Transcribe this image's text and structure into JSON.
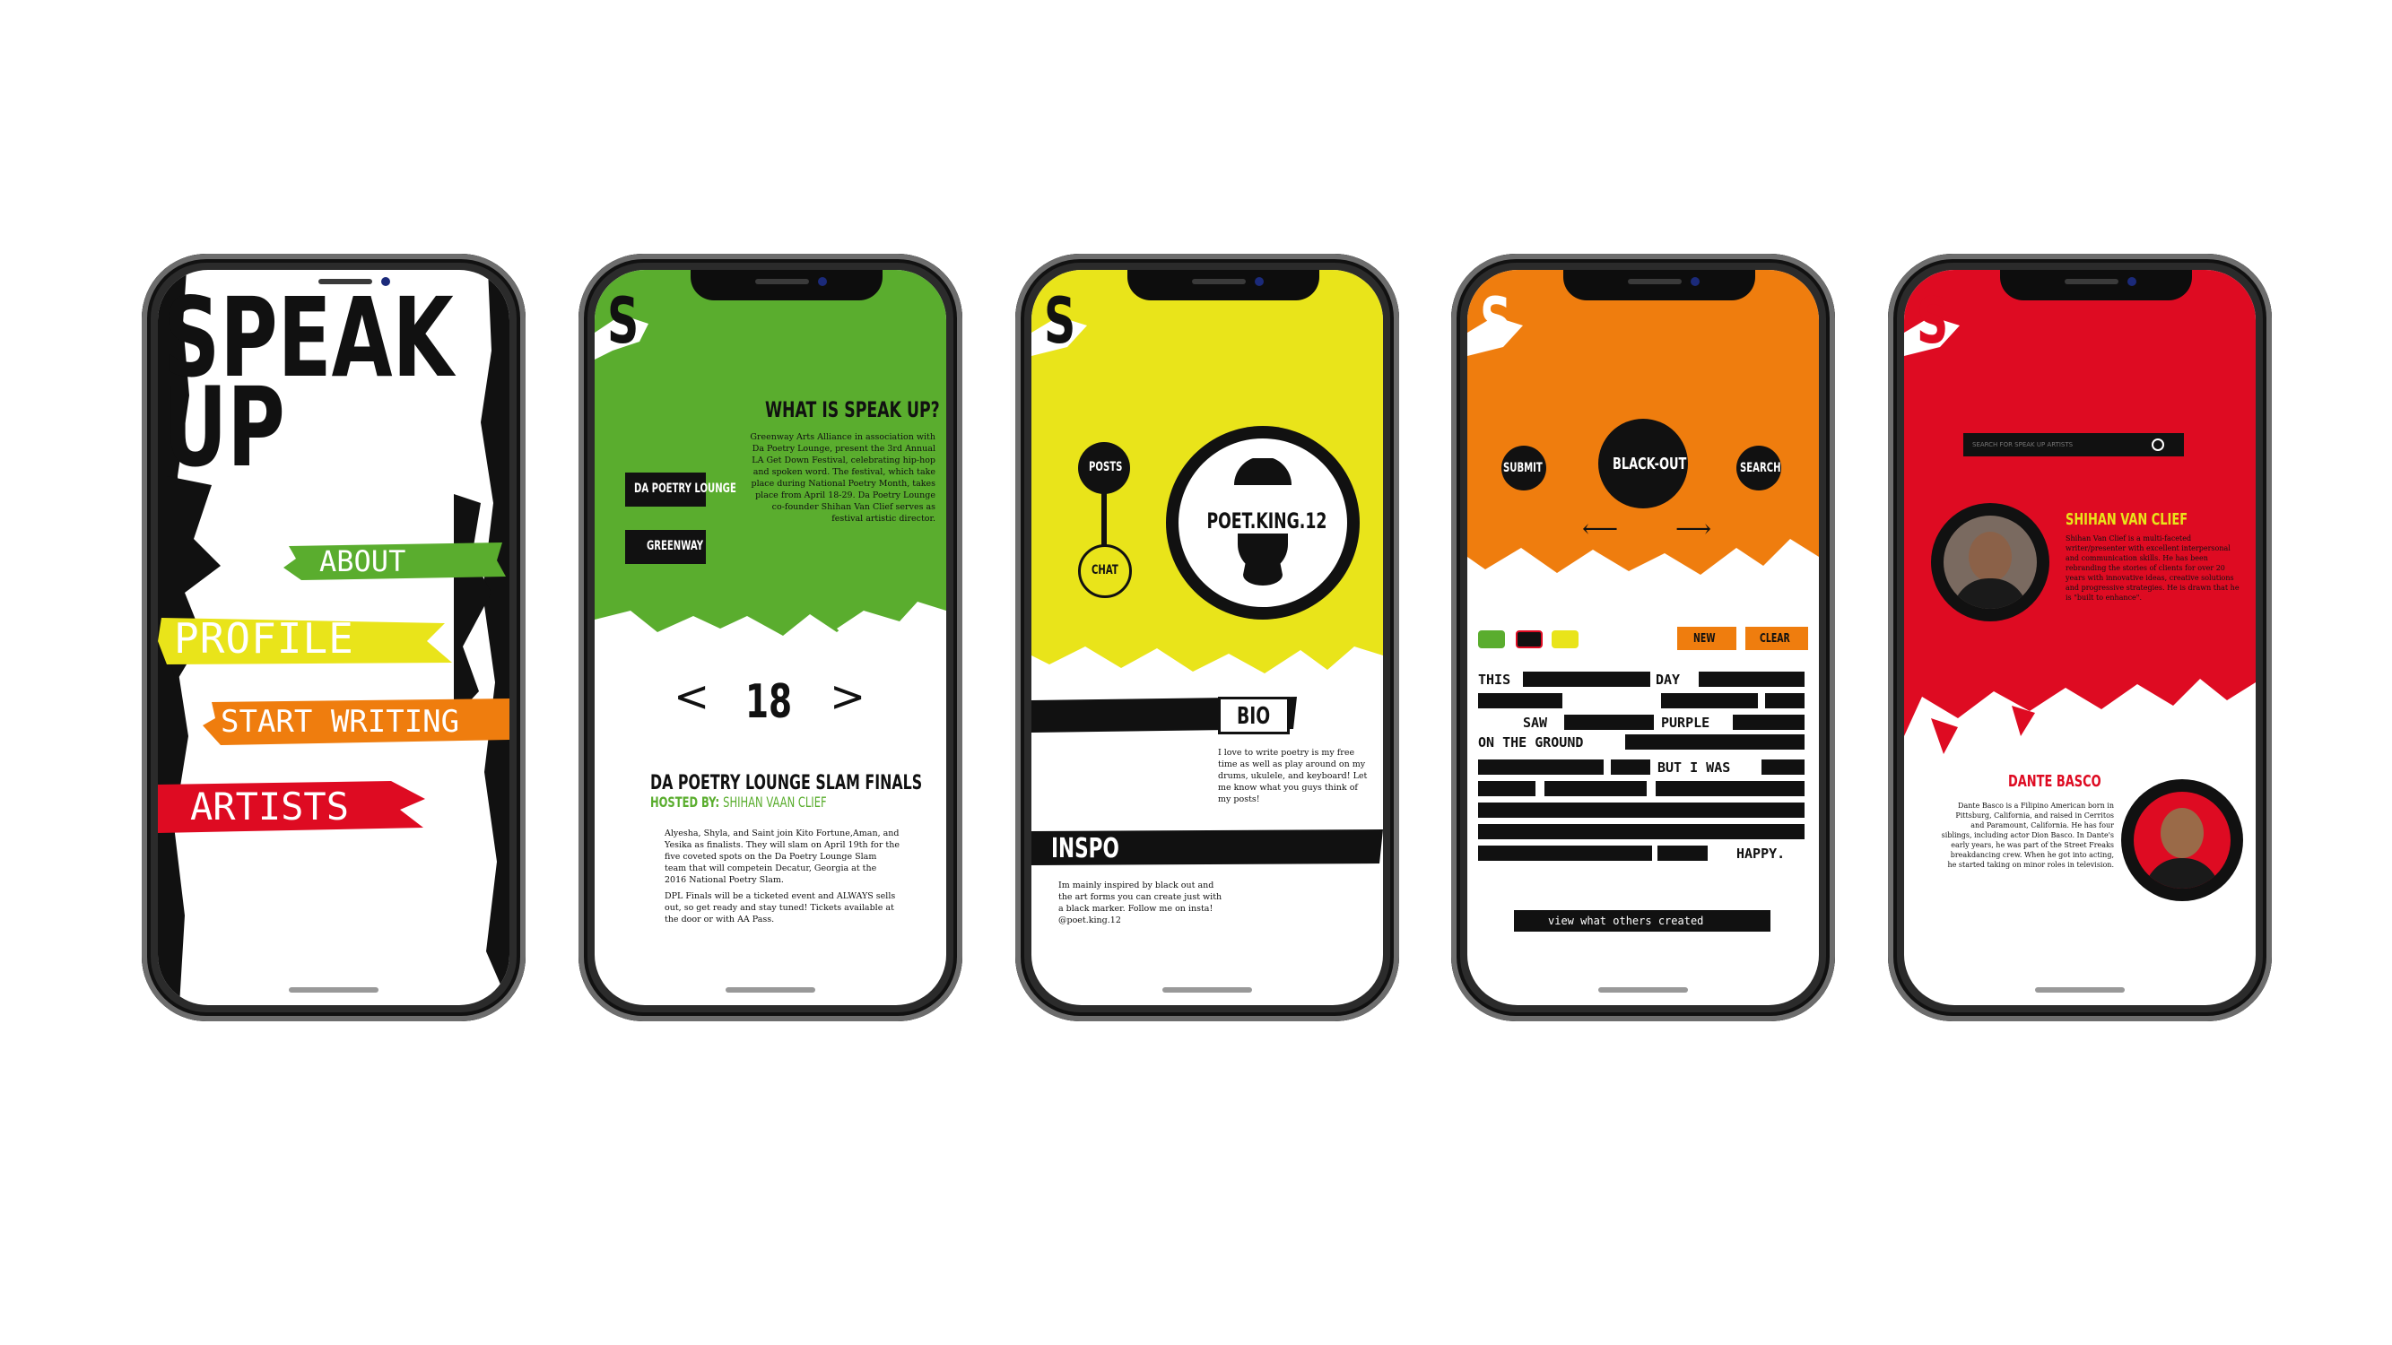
{
  "colors": {
    "green": "#5aad2e",
    "yellow": "#e9e41a",
    "orange": "#ef7d0e",
    "red": "#de0b22",
    "black": "#111111"
  },
  "s_letter": "S",
  "home": {
    "title_line1": "SPEAK",
    "title_line2": "UP",
    "menu": [
      "ABOUT",
      "PROFILE",
      "START WRITING",
      "ARTISTS"
    ]
  },
  "about": {
    "heading": "WHAT IS SPEAK UP?",
    "body": "Greenway Arts Alliance in association with Da Poetry Lounge, present the 3rd Annual LA Get Down Festival, celebrating hip-hop and spoken word. The festival, which take place during National Poetry Month, takes place from April 18-29. Da Poetry Lounge co-founder Shihan Van Clief serves as festival artistic director.",
    "buttons": [
      "DA POETRY LOUNGE",
      "GREENWAY"
    ],
    "date": "18",
    "event_title": "DA POETRY LOUNGE SLAM FINALS",
    "hosted_label": "HOSTED BY:",
    "host": "SHIHAN VAAN CLIEF",
    "para1": "Alyesha, Shyla, and Saint join Kito Fortune,Aman, and Yesika as finalists. They will slam on April 19th for the five coveted spots on the Da Poetry Lounge Slam team that will competein Decatur, Georgia at the 2016 National Poetry Slam.",
    "para2": "DPL Finals will be a ticketed event and ALWAYS sells out, so get ready and stay tuned! Tickets available at the door or with AA Pass."
  },
  "profile": {
    "posts": "POSTS",
    "chat": "CHAT",
    "username": "POET.KING.12",
    "bio_heading": "BIO",
    "bio": "I love to write poetry is my free time as well as play around on my drums, ukulele, and keyboard! Let me know what you guys think of my posts!",
    "inspo_heading": "INSPO",
    "inspo": "Im mainly inspired by black out and the art forms you can create just with a black marker. Follow me on insta! @poet.king.12"
  },
  "write": {
    "submit": "SUBMIT",
    "blackout": "BLACK-OUT",
    "search": "SEARCH",
    "arrow_left": "⟵",
    "arrow_right": "⟶",
    "swatch_colors": [
      "#5aad2e",
      "#111111",
      "#e9e41a"
    ],
    "new": "NEW",
    "clear": "CLEAR",
    "words": [
      "THIS",
      "DAY",
      "SAW",
      "PURPLE",
      "ON THE GROUND",
      "BUT I WAS",
      "HAPPY."
    ],
    "view_others": "view what others created"
  },
  "artists": {
    "search_placeholder": "SEARCH FOR SPEAK UP ARTISTS",
    "artist1_name": "SHIHAN VAN CLIEF",
    "artist1_bio": "Shihan Van Clief is a multi-faceted writer/presenter with excellent interpersonal and communication skills. He has been rebranding the stories of clients for over 20 years with innovative ideas, creative solutions and progressive strategies. He is drawn that he is \"built to enhance\".",
    "artist2_name": "DANTE BASCO",
    "artist2_bio": "Dante Basco is a Filipino American born in Pittsburg, California, and raised in Cerritos and Paramount, California. He has four siblings, including actor Dion Basco. In Dante's early years, he was part of the Street Freaks breakdancing crew. When he got into acting, he started taking on minor roles in television."
  }
}
